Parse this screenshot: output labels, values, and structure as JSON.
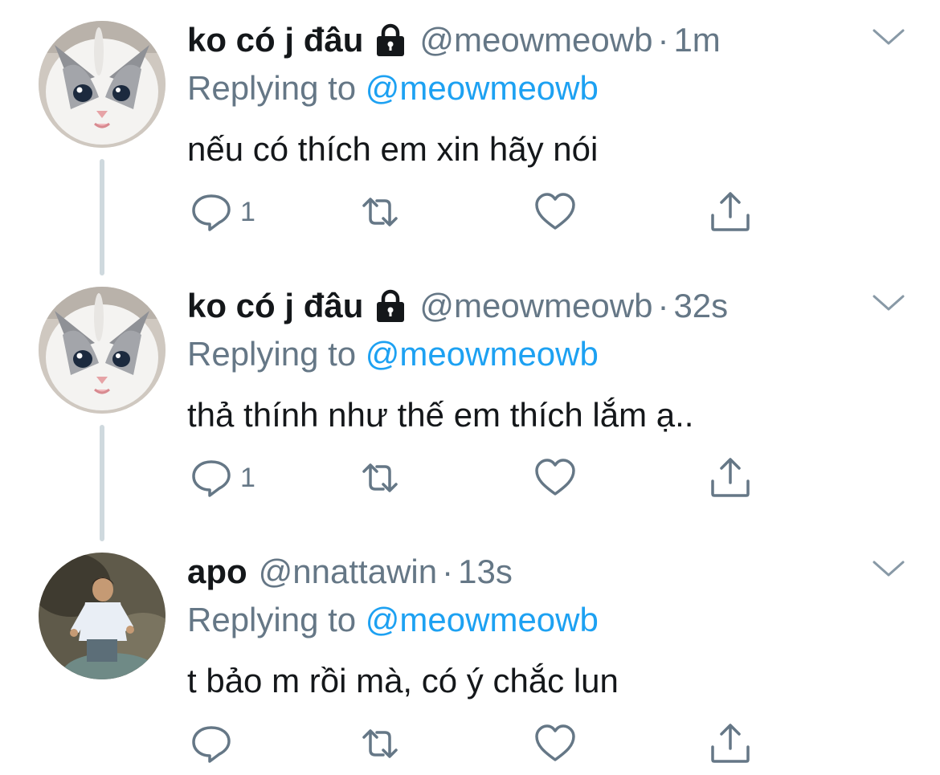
{
  "tweets": [
    {
      "name": "ko có j đâu",
      "locked": true,
      "handle": "@meowmeowb",
      "time": "1m",
      "replying_prefix": "Replying to",
      "replying_to": "@meowmeowb",
      "text": "nếu có thích em xin hãy nói",
      "reply_count": "1",
      "avatar": "kitten-avatar",
      "thread_continues": true
    },
    {
      "name": "ko có j đâu",
      "locked": true,
      "handle": "@meowmeowb",
      "time": "32s",
      "replying_prefix": "Replying to",
      "replying_to": "@meowmeowb",
      "text": "thả thính như thế em thích lắm ạ..",
      "reply_count": "1",
      "avatar": "kitten-avatar",
      "thread_continues": true
    },
    {
      "name": "apo",
      "locked": false,
      "handle": "@nnattawin",
      "time": "13s",
      "replying_prefix": "Replying to",
      "replying_to": "@meowmeowb",
      "text": "t bảo m rồi mà, có ý chắc lun",
      "reply_count": "",
      "avatar": "person-avatar",
      "thread_continues": false
    }
  ],
  "separator": "·",
  "icons": {
    "reply": "reply-icon",
    "retweet": "retweet-icon",
    "like": "heart-icon",
    "share": "share-icon",
    "menu": "chevron-down-icon",
    "lock": "lock-icon"
  },
  "colors": {
    "text": "#14171a",
    "secondary": "#657786",
    "link": "#1da1f2",
    "thread_line": "#cfd9de"
  }
}
